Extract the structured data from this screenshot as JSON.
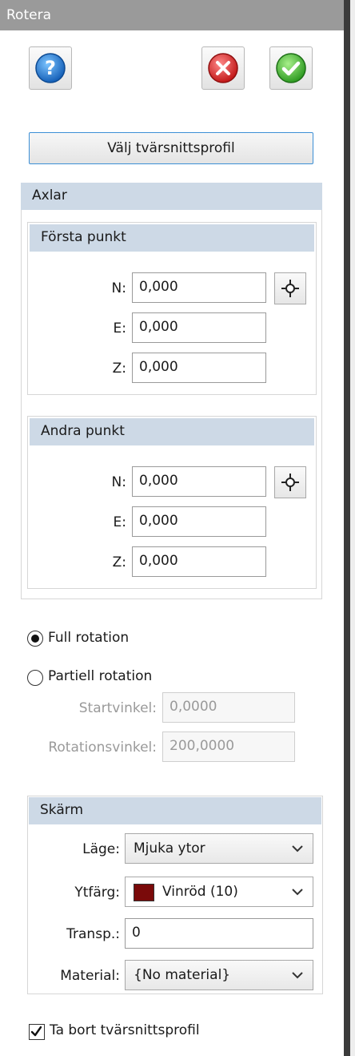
{
  "window": {
    "title": "Rotera"
  },
  "toolbar": {
    "help_icon": "help-icon",
    "cancel_icon": "cancel-icon",
    "ok_icon": "ok-icon"
  },
  "select_profile_button": "Välj tvärsnittsprofil",
  "axes": {
    "title": "Axlar",
    "first_point": {
      "title": "Första punkt",
      "n_label": "N:",
      "n_value": "0,000",
      "e_label": "E:",
      "e_value": "0,000",
      "z_label": "Z:",
      "z_value": "0,000"
    },
    "second_point": {
      "title": "Andra punkt",
      "n_label": "N:",
      "n_value": "0,000",
      "e_label": "E:",
      "e_value": "0,000",
      "z_label": "Z:",
      "z_value": "0,000"
    }
  },
  "rotation": {
    "full_label": "Full rotation",
    "full_selected": true,
    "partial_label": "Partiell rotation",
    "partial_selected": false,
    "start_angle_label": "Startvinkel:",
    "start_angle_value": "0,0000",
    "rotation_angle_label": "Rotationsvinkel:",
    "rotation_angle_value": "200,0000"
  },
  "display": {
    "title": "Skärm",
    "mode_label": "Läge:",
    "mode_value": "Mjuka ytor",
    "surface_color_label": "Ytfärg:",
    "surface_color_value": "Vinröd (10)",
    "surface_color_hex": "#7a0a0a",
    "transp_label": "Transp.:",
    "transp_value": "0",
    "material_label": "Material:",
    "material_value": "{No material}"
  },
  "remove_profile": {
    "label": "Ta bort tvärsnittsprofil",
    "checked": true
  },
  "colors": {
    "title_bg": "#9a9a9a",
    "group_header_bg": "#cdd9e6",
    "accent_border": "#3c8fd6"
  }
}
